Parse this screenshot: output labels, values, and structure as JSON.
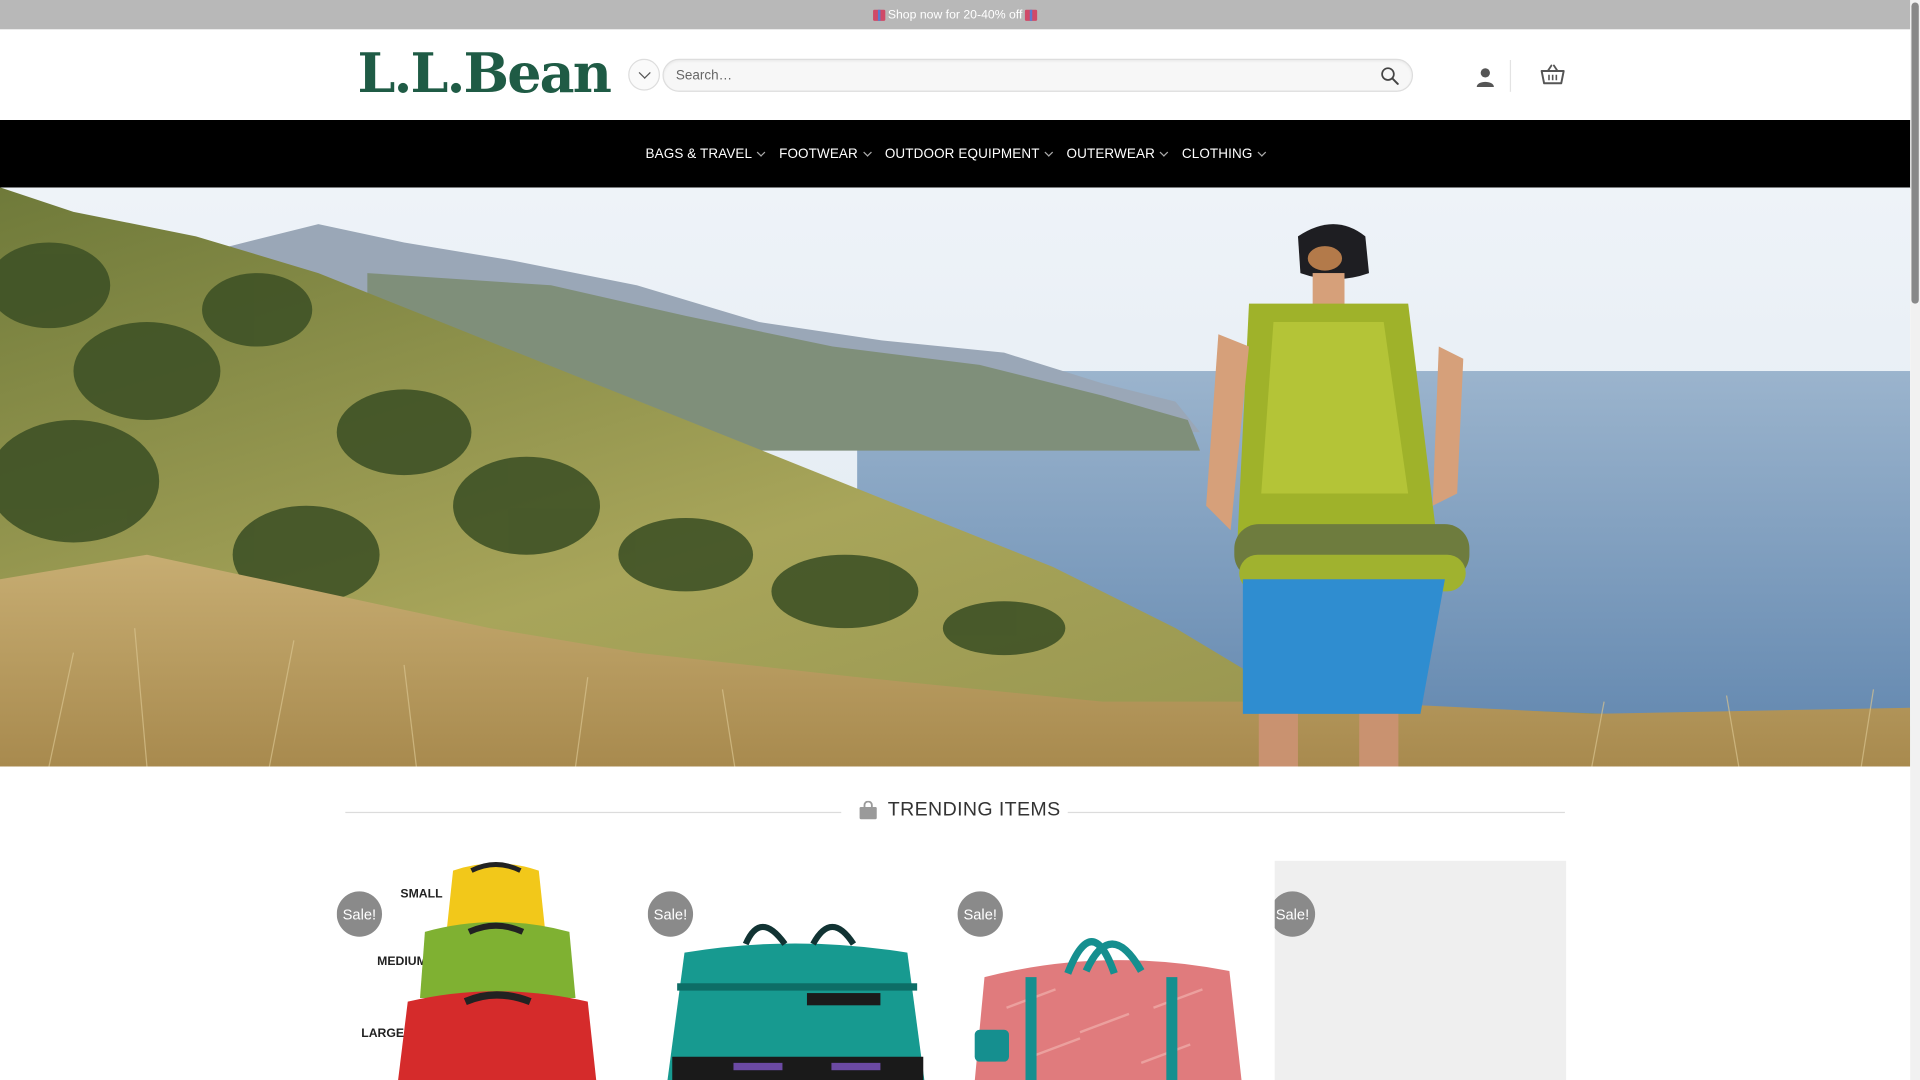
{
  "announcement": {
    "text": "Shop now for 20-40% off"
  },
  "header": {
    "logo": "L.L.Bean",
    "search_placeholder": "Search…",
    "icons": [
      "chevron-down-icon",
      "search-icon",
      "account-icon",
      "cart-icon"
    ]
  },
  "nav": {
    "items": [
      {
        "label": "BAGS & TRAVEL"
      },
      {
        "label": "FOOTWEAR"
      },
      {
        "label": "OUTDOOR EQUIPMENT"
      },
      {
        "label": "OUTERWEAR"
      },
      {
        "label": "CLOTHING"
      }
    ]
  },
  "hero": {
    "image": "hiker with backpack overlooking coastal hills"
  },
  "trending": {
    "title": "TRENDING ITEMS",
    "icon": "shopping-bag-icon"
  },
  "products": [
    {
      "badge": "Sale!",
      "size_labels": [
        "SMALL",
        "MEDIUM",
        "LARGE"
      ]
    },
    {
      "badge": "Sale!"
    },
    {
      "badge": "Sale!"
    },
    {
      "badge": "Sale!"
    }
  ],
  "colors": {
    "brand_green": "#1f5b45",
    "nav_bg": "#000000",
    "topbar_bg": "#b8b8b8",
    "sale_badge": "#8a8a8a"
  }
}
